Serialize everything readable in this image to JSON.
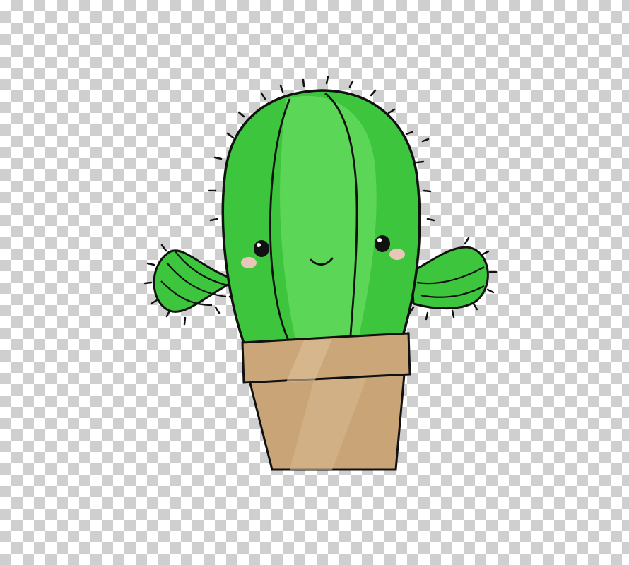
{
  "illustration": {
    "subject": "cactus-in-pot",
    "background": "transparency-checkerboard",
    "colors": {
      "checker_light": "#ffffff",
      "checker_dark": "#cfcfcf",
      "cactus_body": "#3dc53d",
      "cactus_highlight": "#62d85a",
      "cactus_shade": "#2aa82a",
      "outline": "#111111",
      "blush": "#e8c7b8",
      "pot": "#c8a477",
      "pot_rim": "#caa678",
      "pot_shade": "#b48d5d"
    },
    "expression": "smiling"
  }
}
